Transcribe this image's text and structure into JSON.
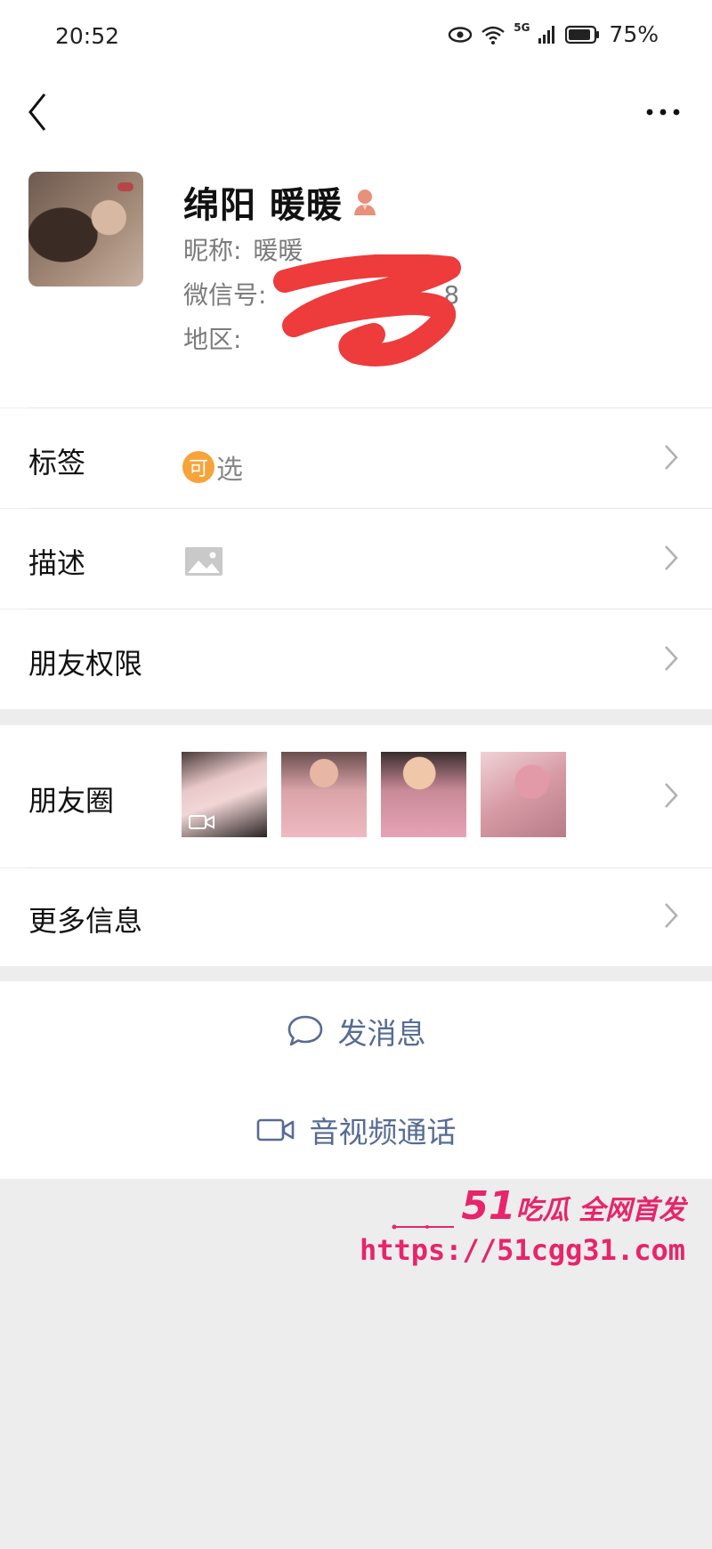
{
  "status_bar": {
    "time": "20:52",
    "network": "5G",
    "battery": "75%"
  },
  "profile": {
    "name": "绵阳 暖暖",
    "nickname_label": "昵称:",
    "nickname": "暖暖",
    "wechat_id_label": "微信号:",
    "wechat_id_visible": "8",
    "region_label": "地区:",
    "region_visible": "",
    "gender_icon": "female-icon"
  },
  "rows": {
    "tags_label": "标签",
    "tags_badge": "可",
    "tags_value": "选",
    "description_label": "描述",
    "permissions_label": "朋友权限",
    "moments_label": "朋友圈",
    "more_info_label": "更多信息"
  },
  "actions": {
    "message": "发消息",
    "call": "音视频通话"
  },
  "watermark": {
    "brand_number": "51",
    "brand_text": "吃瓜 全网首发",
    "url": "https://51cgg31.com"
  },
  "colors": {
    "accent_link": "#576b95",
    "tag_badge": "#f7a339",
    "watermark": "#e8246b",
    "background": "#ededed"
  }
}
